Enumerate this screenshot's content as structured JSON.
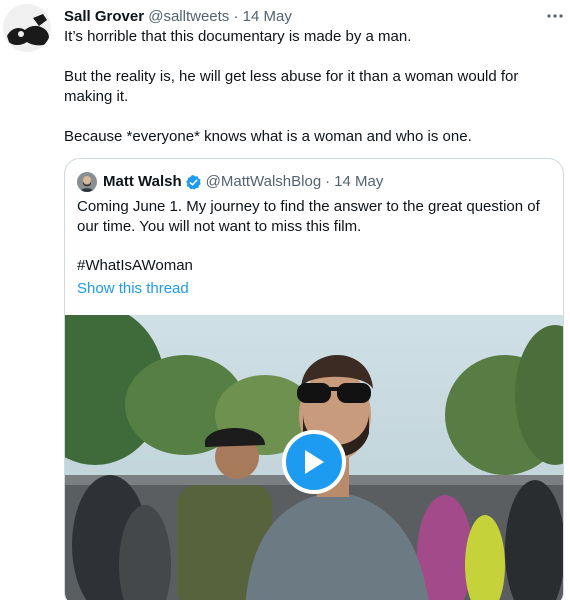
{
  "tweet": {
    "author_name": "Sall Grover",
    "author_handle": "@salltweets",
    "separator": "·",
    "date": "14 May",
    "more_icon": "more-dots-icon",
    "paragraphs": [
      "It’s horrible that this documentary is made by a man.",
      "But the reality is, he will get less abuse for it than a woman would for making it.",
      "Because *everyone* knows what is a woman and who is one."
    ]
  },
  "quoted": {
    "author_name": "Matt Walsh",
    "verified_icon": "verified-badge-icon",
    "author_handle": "@MattWalshBlog",
    "separator": "·",
    "date": "14 May",
    "text": "Coming June 1. My journey to find the answer to the great question of our time. You will not want to miss this film.",
    "hashtag": "#WhatIsAWoman",
    "show_thread": "Show this thread",
    "media_icon": "play-icon"
  },
  "colors": {
    "accent": "#1d9bf0",
    "secondary_text": "#536471",
    "border": "#cfd9de"
  }
}
